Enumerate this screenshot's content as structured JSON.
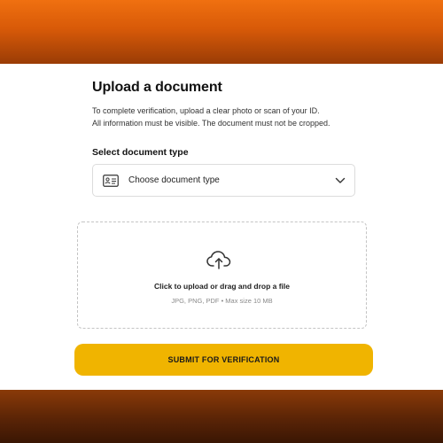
{
  "page": {
    "title": "Upload a document",
    "instructions": [
      "To complete verification, upload a clear photo or scan of your ID.",
      "All information must be visible. The document must not be cropped."
    ]
  },
  "document_type": {
    "label": "Select document type",
    "placeholder": "Choose document type",
    "icon": "id-card-icon"
  },
  "upload": {
    "icon": "cloud-upload-icon",
    "prompt": "Click to upload or drag and drop a file",
    "hint": "JPG, PNG, PDF • Max size 10 MB"
  },
  "submit": {
    "label": "SUBMIT FOR VERIFICATION"
  },
  "colors": {
    "accent": "#f0b400",
    "header_band": "#e06410",
    "footer_band": "#5a2406",
    "border": "#dcdcdc"
  }
}
